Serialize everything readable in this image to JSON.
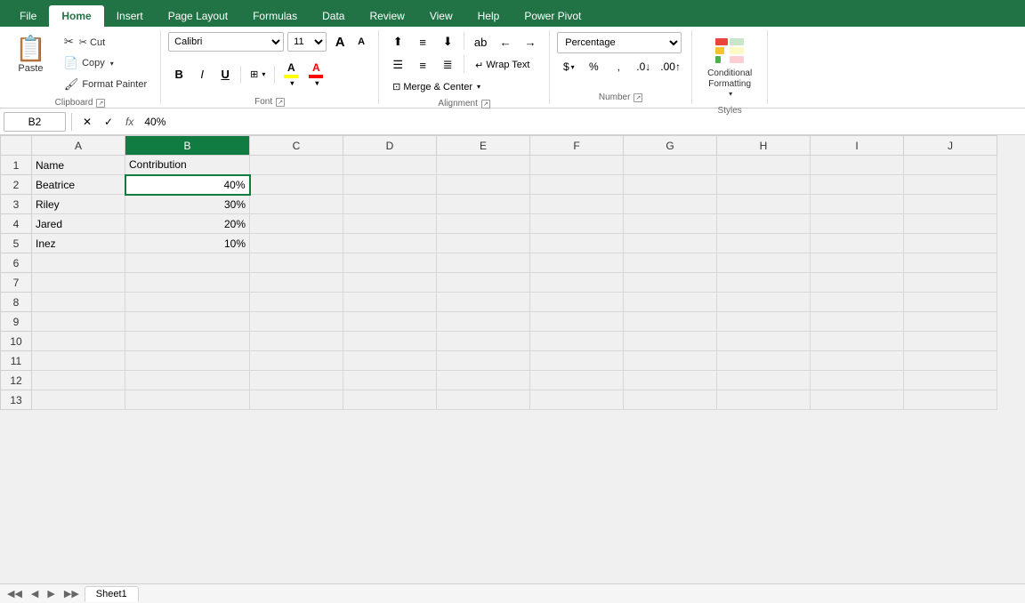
{
  "tabs": {
    "items": [
      "File",
      "Home",
      "Insert",
      "Page Layout",
      "Formulas",
      "Data",
      "Review",
      "View",
      "Help",
      "Power Pivot"
    ],
    "active": "Home"
  },
  "ribbon": {
    "clipboard": {
      "label": "Clipboard",
      "paste_label": "Paste",
      "cut_label": "✂ Cut",
      "copy_label": "Copy",
      "format_painter_label": "Format Painter"
    },
    "font": {
      "label": "Font",
      "font_name": "Calibri",
      "font_size": "11",
      "bold": "B",
      "italic": "I",
      "underline": "U",
      "increase_size": "A",
      "decrease_size": "A",
      "fill_color": "A",
      "font_color": "A"
    },
    "alignment": {
      "label": "Alignment",
      "wrap_text": "Wrap Text",
      "merge_center": "Merge & Center"
    },
    "number": {
      "label": "Number",
      "format": "Percentage"
    },
    "styles": {
      "label": "Styles",
      "conditional_formatting": "Conditional\nFormatting"
    }
  },
  "formula_bar": {
    "cell_ref": "B2",
    "value": "40%"
  },
  "grid": {
    "columns": [
      "",
      "A",
      "B",
      "C",
      "D",
      "E",
      "F",
      "G",
      "H",
      "I",
      "J"
    ],
    "selected_col": "B",
    "selected_row": 2,
    "selected_cell": "B2",
    "rows": [
      {
        "row": 1,
        "cells": [
          "Name",
          "Contribution",
          "",
          "",
          "",
          "",
          "",
          "",
          "",
          ""
        ]
      },
      {
        "row": 2,
        "cells": [
          "Beatrice",
          "40%",
          "",
          "",
          "",
          "",
          "",
          "",
          "",
          ""
        ]
      },
      {
        "row": 3,
        "cells": [
          "Riley",
          "30%",
          "",
          "",
          "",
          "",
          "",
          "",
          "",
          ""
        ]
      },
      {
        "row": 4,
        "cells": [
          "Jared",
          "20%",
          "",
          "",
          "",
          "",
          "",
          "",
          "",
          ""
        ]
      },
      {
        "row": 5,
        "cells": [
          "Inez",
          "10%",
          "",
          "",
          "",
          "",
          "",
          "",
          "",
          ""
        ]
      },
      {
        "row": 6,
        "cells": [
          "",
          "",
          "",
          "",
          "",
          "",
          "",
          "",
          "",
          ""
        ]
      },
      {
        "row": 7,
        "cells": [
          "",
          "",
          "",
          "",
          "",
          "",
          "",
          "",
          "",
          ""
        ]
      },
      {
        "row": 8,
        "cells": [
          "",
          "",
          "",
          "",
          "",
          "",
          "",
          "",
          "",
          ""
        ]
      },
      {
        "row": 9,
        "cells": [
          "",
          "",
          "",
          "",
          "",
          "",
          "",
          "",
          "",
          ""
        ]
      },
      {
        "row": 10,
        "cells": [
          "",
          "",
          "",
          "",
          "",
          "",
          "",
          "",
          "",
          ""
        ]
      },
      {
        "row": 11,
        "cells": [
          "",
          "",
          "",
          "",
          "",
          "",
          "",
          "",
          "",
          ""
        ]
      },
      {
        "row": 12,
        "cells": [
          "",
          "",
          "",
          "",
          "",
          "",
          "",
          "",
          "",
          ""
        ]
      },
      {
        "row": 13,
        "cells": [
          "",
          "",
          "",
          "",
          "",
          "",
          "",
          "",
          "",
          ""
        ]
      }
    ]
  },
  "sheet_tabs": [
    "Sheet1"
  ],
  "active_sheet": "Sheet1",
  "colors": {
    "excel_green": "#217346",
    "selected_green": "#107c41",
    "fill_yellow": "#FFFF00",
    "font_red": "#FF0000"
  }
}
